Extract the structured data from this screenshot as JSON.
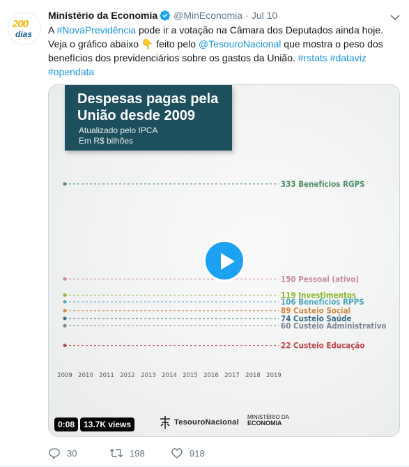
{
  "account": {
    "avatar_top": "200",
    "avatar_bottom": "dias",
    "display_name": "Ministério da Economia",
    "handle": "@MinEconomia",
    "separator": "·",
    "date": "Jul 10"
  },
  "tweet": {
    "t1": "A ",
    "hashtag1": "#NovaPrevidência",
    "t2": " pode ir a votação na Câmara dos Deputados ainda hoje. Veja o gráfico abaixo ",
    "emoji": "👇",
    "t3": " feito pelo ",
    "mention": "@TesouroNacional",
    "t4": " que mostra o peso dos benefícios dos previdenciários sobre os gastos da União. ",
    "hashtag2": "#rstats",
    "hashtag3": "#dataviz",
    "hashtag4": "#opendata"
  },
  "media": {
    "title_line1": "Despesas pagas pela",
    "title_line2": "União desde 2009",
    "subtitle_line1": "Atualizado pelo IPCA",
    "subtitle_line2": "Em R$ bilhões",
    "logo_tesouro": "TesouroNacional",
    "logo_min_line1": "MINISTÉRIO DA",
    "logo_min_line2": "ECONOMIA",
    "duration": "0:08",
    "views": "13.7K views"
  },
  "chart_data": {
    "type": "line",
    "title": "Despesas pagas pela União desde 2009",
    "subtitle": "Atualizado pelo IPCA · Em R$ bilhões",
    "x": [
      "2009",
      "2010",
      "2011",
      "2012",
      "2013",
      "2014",
      "2015",
      "2016",
      "2017",
      "2018",
      "2019"
    ],
    "series": [
      {
        "name": "Benefícios RGPS",
        "value": 333,
        "label": "333 Benefícios RGPS",
        "color": "#4f8f6b"
      },
      {
        "name": "Pessoal (ativo)",
        "value": 150,
        "label": "150 Pessoal (ativo)",
        "color": "#c48a9a"
      },
      {
        "name": "Investimentos",
        "value": 119,
        "label": "119 Investimentos",
        "color": "#8ab82e"
      },
      {
        "name": "Benefícios RPPS",
        "value": 106,
        "label": "106 Benefícios RPPS",
        "color": "#4fa8c2"
      },
      {
        "name": "Custeio Social",
        "value": 89,
        "label": "89 Custeio Social",
        "color": "#d28a44"
      },
      {
        "name": "Custeio Saúde",
        "value": 74,
        "label": "74 Custeio Saúde",
        "color": "#3e6f88"
      },
      {
        "name": "Custeio Administrativo",
        "value": 60,
        "label": "60 Custeio Administrativo",
        "color": "#7d8890"
      },
      {
        "name": "Custeio Educação",
        "value": 22,
        "label": "22 Custeio Educação",
        "color": "#c0454a"
      }
    ],
    "grid": false,
    "legend": "right-end labels"
  },
  "actions": {
    "replies": "30",
    "retweets": "198",
    "likes": "918"
  }
}
